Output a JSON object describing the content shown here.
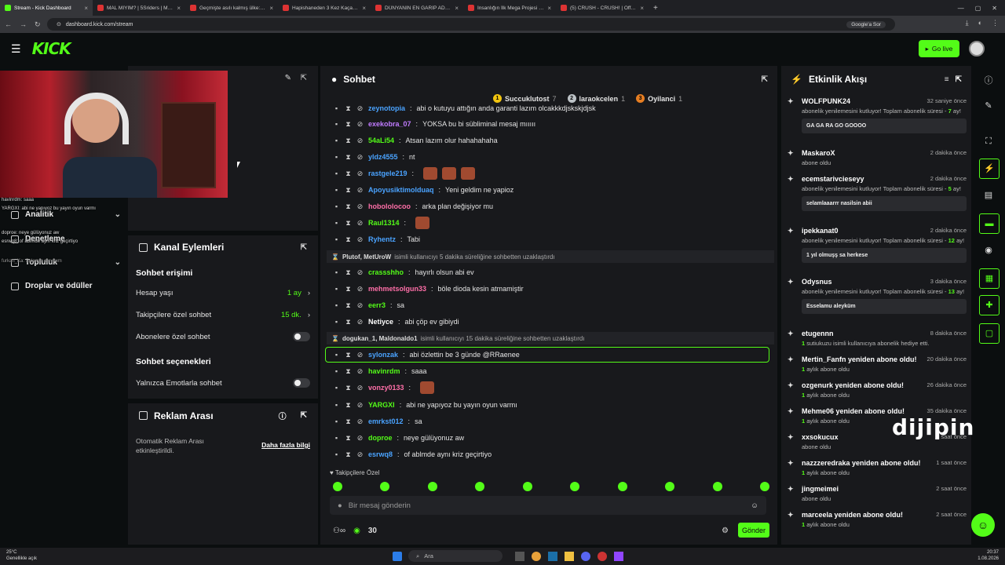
{
  "browser": {
    "tabs": [
      {
        "title": "Stream - Kick Dashboard",
        "active": true
      },
      {
        "title": "MAL MIYIM? | 5Sriders | Motos",
        "active": false
      },
      {
        "title": "Geçmişte asılı kalmış ülke: Küba",
        "active": false
      },
      {
        "title": "Hapishaneden 3 Kez Kaçan Ad",
        "active": false
      },
      {
        "title": "DÜNYANIN EN GARİP ADASINI",
        "active": false
      },
      {
        "title": "İnsanlığın İlk Mega Projesi Göb",
        "active": false
      },
      {
        "title": "(5) CRUSH - CRUSH! | Official h",
        "active": false
      }
    ],
    "url": "dashboard.kick.com/stream",
    "google_search_label": "Google'a Sor"
  },
  "header": {
    "logo": "KICK",
    "go_live_label": "Go live"
  },
  "leftnav": {
    "items": [
      {
        "label": "Analitik",
        "has_chevron": true
      },
      {
        "label": "Denetleme",
        "has_chevron": false
      },
      {
        "label": "Topluluk",
        "has_chevron": true
      },
      {
        "label": "Droplar ve ödüller",
        "has_chevron": false
      }
    ],
    "stream_overlay_chat": [
      "havinrdm: saaa",
      "YARGXI: abi ne yapıyoz bu yayın oyun varmı",
      "doproe: neye gülüyonuz aw",
      "esrwq8: of ablmde aynı kriz geçirtiyo",
      "furkan_Ka: Selamın aleykum"
    ]
  },
  "channel_actions": {
    "title": "Kanal Eylemleri",
    "chat_access_heading": "Sohbet erişimi",
    "rows": [
      {
        "label": "Hesap yaşı",
        "value": "1 ay"
      },
      {
        "label": "Takipçilere özel sohbet",
        "value": "15 dk."
      }
    ],
    "subscriber_only_label": "Abonelere özel sohbet",
    "chat_options_heading": "Sohbet seçenekleri",
    "emote_only_label": "Yalnızca Emotlarla sohbet"
  },
  "ad_break": {
    "title": "Reklam Arası",
    "description": "Otomatik Reklam Arası etkinleştirildi.",
    "more_info_label": "Daha fazla bilgi"
  },
  "chat": {
    "title": "Sohbet",
    "top_badges": [
      {
        "rank": "1",
        "name": "Succuklutost",
        "count": "7",
        "color": "#f1c40f"
      },
      {
        "rank": "2",
        "name": "laraokcelen",
        "count": "1",
        "color": "#bdc3c7"
      },
      {
        "rank": "3",
        "name": "Oyilanci",
        "count": "1",
        "color": "#e67e22"
      }
    ],
    "messages": [
      {
        "user": "zeynotopia",
        "text": "abi o kutuyu attığın anda garanti lazım olcakkkdjskskjdjsk",
        "color": "#4aa3ff"
      },
      {
        "user": "exekobra_07",
        "text": "YOKSA bu bi sübliminal mesaj mııııı",
        "color": "#c07bff"
      },
      {
        "user": "54aLi54",
        "text": "Atsan lazım olur hahahahaha",
        "color": "#53fc18"
      },
      {
        "user": "yldz4555",
        "text": "nt",
        "color": "#4aa3ff"
      },
      {
        "user": "rastgele219",
        "text": "",
        "color": "#4aa3ff"
      },
      {
        "user": "Apoyusiktimolduaq",
        "text": "Yeni geldim ne yapioz",
        "color": "#4aa3ff"
      },
      {
        "user": "hobololocoo",
        "text": "arka plan değişiyor mu",
        "color": "#ff6fa8"
      },
      {
        "user": "Raul1314",
        "text": "",
        "color": "#53fc18"
      },
      {
        "user": "Ryhentz",
        "text": "Tabi",
        "color": "#4aa3ff"
      },
      {
        "user": "crassshho",
        "text": "hayırlı olsun abi ev",
        "color": "#53fc18"
      },
      {
        "user": "mehmetsolgun33",
        "text": "böle dioda kesin atmamiştir",
        "color": "#ff6fa8"
      },
      {
        "user": "eerr3",
        "text": "sa",
        "color": "#53fc18"
      },
      {
        "user": "Netiyce",
        "text": "abi çöp ev gibiydi",
        "color": "#ffffff"
      },
      {
        "user": "sylonzak",
        "text": "abi özlettin be 3 günde @RRaenee",
        "color": "#4aa3ff"
      },
      {
        "user": "havinrdm",
        "text": "saaa",
        "color": "#53fc18"
      },
      {
        "user": "vonzy0133",
        "text": "",
        "color": "#ff6fa8"
      },
      {
        "user": "YARGXI",
        "text": "abi ne yapıyoz bu yayın oyun varmı",
        "color": "#53fc18"
      },
      {
        "user": "emrkst012",
        "text": "sa",
        "color": "#4aa3ff"
      },
      {
        "user": "doproe",
        "text": "neye gülüyonuz aw",
        "color": "#53fc18"
      },
      {
        "user": "esrwq8",
        "text": "of ablmde aynı kriz geçirtiyo",
        "color": "#4aa3ff"
      }
    ],
    "system_messages": [
      {
        "users": "Plutof, MetUroW",
        "text": "isimli kullanıcıyı 5 dakika süreliğine sohbetten uzaklaştırdı"
      },
      {
        "users": "dogukan_1, Maldonaldo1",
        "text": "isimli kullanıcıyı 15 dakika süreliğine sohbetten uzaklaştırdı"
      }
    ],
    "follower_only_label": "Takipçilere Özel",
    "input_placeholder": "Bir mesaj gönderin",
    "points": "30",
    "send_label": "Gönder"
  },
  "activity": {
    "title": "Etkinlik Akışı",
    "events": [
      {
        "name": "WOLFPUNK24",
        "time": "32 saniye önce",
        "desc_pre": "abonelik yenilemesini kutluyor! Toplam abonelik süresi -",
        "months": "7",
        "desc_post": "ay!",
        "quote": "GA GA RA GO GOOOO"
      },
      {
        "name": "MaskaroX",
        "time": "2 dakika önce",
        "desc_pre": "abone oldu",
        "months": "",
        "desc_post": "",
        "quote": ""
      },
      {
        "name": "ecemstarivcieseyy",
        "time": "2 dakika önce",
        "desc_pre": "abonelik yenilemesini kutluyor! Toplam abonelik süresi -",
        "months": "5",
        "desc_post": "ay!",
        "quote": "selamlaaarrr nasilsin abii"
      },
      {
        "name": "ipekkanat0",
        "time": "2 dakika önce",
        "desc_pre": "abonelik yenilemesini kutluyor! Toplam abonelik süresi -",
        "months": "12",
        "desc_post": "ay!",
        "quote": "1 yıl olmuşş sa herkese"
      },
      {
        "name": "Odysnus",
        "time": "3 dakika önce",
        "desc_pre": "abonelik yenilemesini kutluyor! Toplam abonelik süresi -",
        "months": "13",
        "desc_post": "ay!",
        "quote": "Esselamu aleyküm"
      },
      {
        "name": "etugennn",
        "time": "8 dakika önce",
        "desc_pre": "",
        "months": "1",
        "desc_post": "sutiukuzu isimli kullanıcıya abonelik hediye etti.",
        "quote": ""
      },
      {
        "name": "Mertin_Fanfn yeniden abone oldu!",
        "time": "20 dakika önce",
        "desc_pre": "",
        "months": "1",
        "desc_post": "aylık abone oldu",
        "quote": ""
      },
      {
        "name": "ozgenurk yeniden abone oldu!",
        "time": "26 dakika önce",
        "desc_pre": "",
        "months": "1",
        "desc_post": "aylık abone oldu",
        "quote": ""
      },
      {
        "name": "Mehme06 yeniden abone oldu!",
        "time": "35 dakika önce",
        "desc_pre": "",
        "months": "1",
        "desc_post": "aylık abone oldu",
        "quote": ""
      },
      {
        "name": "xxsokucux",
        "time": "1 saat önce",
        "desc_pre": "abone oldu",
        "months": "",
        "desc_post": "",
        "quote": ""
      },
      {
        "name": "nazzzeredraka yeniden abone oldu!",
        "time": "1 saat önce",
        "desc_pre": "",
        "months": "1",
        "desc_post": "aylık abone oldu",
        "quote": ""
      },
      {
        "name": "jingmeimei",
        "time": "2 saat önce",
        "desc_pre": "abone oldu",
        "months": "",
        "desc_post": "",
        "quote": ""
      },
      {
        "name": "marceela yeniden abone oldu!",
        "time": "2 saat önce",
        "desc_pre": "",
        "months": "1",
        "desc_post": "aylık abone oldu",
        "quote": ""
      }
    ]
  },
  "watermark": "dijipin",
  "taskbar": {
    "weather_temp": "25°C",
    "weather_desc": "Genellikle açık",
    "search_label": "Ara",
    "time": "20:37",
    "date": "1.08.2026"
  }
}
